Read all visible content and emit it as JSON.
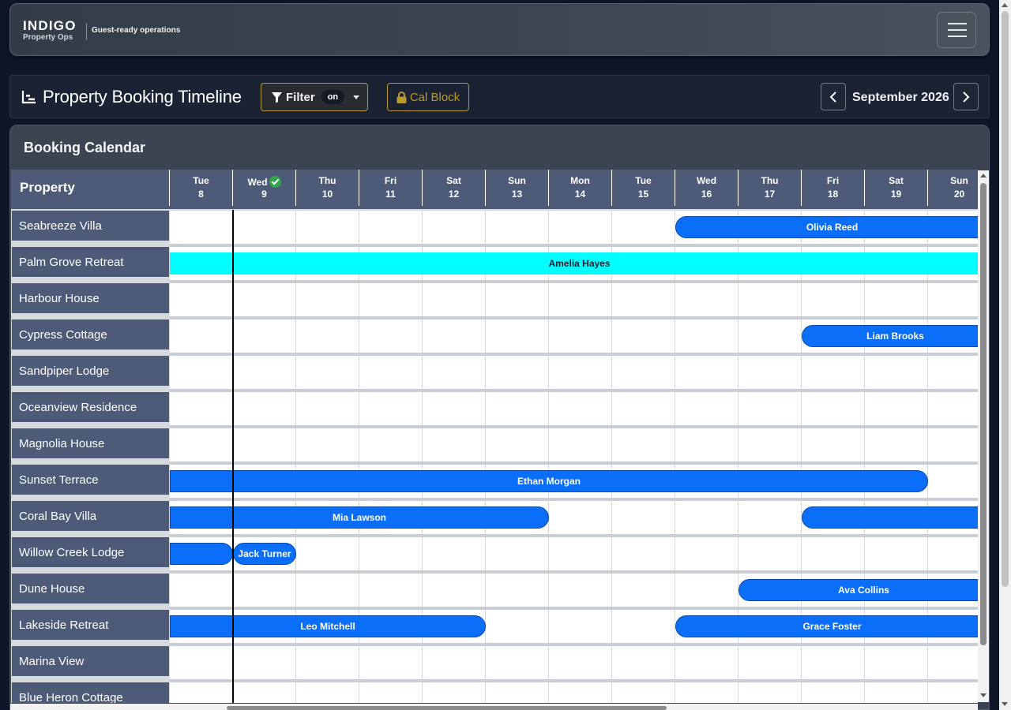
{
  "brand": {
    "name": "INDIGO",
    "sub": "Property Ops",
    "tagline": "Guest-ready operations"
  },
  "toolbar": {
    "title": "Property Booking Timeline",
    "filter_label": "Filter",
    "filter_state": "on",
    "calblock_label": "Cal Block",
    "month": "September 2026",
    "accent_color": "#b8992b"
  },
  "calendar": {
    "title": "Booking Calendar",
    "property_header": "Property",
    "days": [
      {
        "name": "Tue",
        "date": "8"
      },
      {
        "name": "Wed",
        "date": "9",
        "today": true
      },
      {
        "name": "Thu",
        "date": "10"
      },
      {
        "name": "Fri",
        "date": "11"
      },
      {
        "name": "Sat",
        "date": "12"
      },
      {
        "name": "Sun",
        "date": "13"
      },
      {
        "name": "Mon",
        "date": "14"
      },
      {
        "name": "Tue",
        "date": "15"
      },
      {
        "name": "Wed",
        "date": "16"
      },
      {
        "name": "Thu",
        "date": "17"
      },
      {
        "name": "Fri",
        "date": "18"
      },
      {
        "name": "Sat",
        "date": "19"
      },
      {
        "name": "Sun",
        "date": "20"
      }
    ],
    "properties": [
      {
        "name": "Seabreeze Villa",
        "bookings": [
          {
            "guest": "Olivia Reed",
            "start": 7.5,
            "end": 13.3,
            "color": "blue"
          }
        ]
      },
      {
        "name": "Palm Grove Retreat",
        "bookings": [
          {
            "guest": "Amelia Hayes",
            "start": -0.5,
            "end": 13.3,
            "color": "cyan"
          }
        ]
      },
      {
        "name": "Harbour House",
        "bookings": []
      },
      {
        "name": "Cypress Cottage",
        "bookings": [
          {
            "guest": "Liam Brooks",
            "start": 9.5,
            "end": 13.3,
            "color": "blue"
          }
        ]
      },
      {
        "name": "Sandpiper Lodge",
        "bookings": []
      },
      {
        "name": "Oceanview Residence",
        "bookings": []
      },
      {
        "name": "Magnolia House",
        "bookings": []
      },
      {
        "name": "Sunset Terrace",
        "bookings": [
          {
            "guest": "Ethan Morgan",
            "start": -0.5,
            "end": 11.5,
            "color": "blue"
          }
        ]
      },
      {
        "name": "Coral Bay Villa",
        "bookings": [
          {
            "guest": "Mia Lawson",
            "start": -0.5,
            "end": 5.5,
            "color": "blue"
          },
          {
            "guest": "",
            "start": 9.5,
            "end": 13.3,
            "color": "blue"
          }
        ]
      },
      {
        "name": "Willow Creek Lodge",
        "bookings": [
          {
            "guest": "",
            "start": -0.5,
            "end": 0.5,
            "color": "blue"
          },
          {
            "guest": "Jack Turner",
            "start": 0.5,
            "end": 1.5,
            "color": "blue"
          }
        ]
      },
      {
        "name": "Dune House",
        "bookings": [
          {
            "guest": "Ava Collins",
            "start": 8.5,
            "end": 13.3,
            "color": "blue"
          }
        ]
      },
      {
        "name": "Lakeside Retreat",
        "bookings": [
          {
            "guest": "Leo Mitchell",
            "start": -0.5,
            "end": 4.5,
            "color": "blue"
          },
          {
            "guest": "Grace Foster",
            "start": 7.5,
            "end": 12.5,
            "color": "blue"
          }
        ]
      },
      {
        "name": "Marina View",
        "bookings": []
      },
      {
        "name": "Blue Heron Cottage",
        "bookings": []
      }
    ]
  }
}
